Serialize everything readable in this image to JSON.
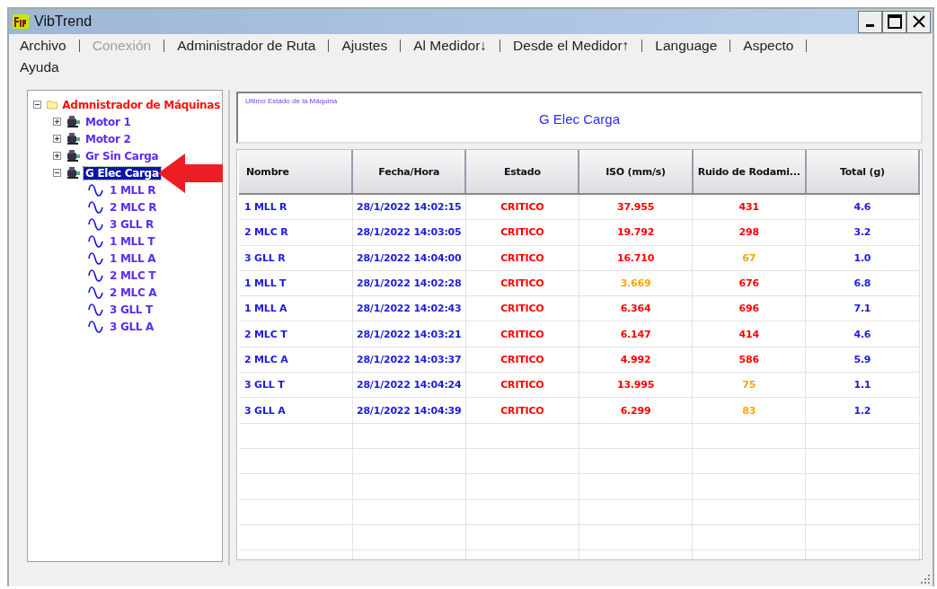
{
  "window": {
    "title": "VibTrend"
  },
  "menu": [
    {
      "label": "Archivo",
      "disabled": false
    },
    {
      "label": "Conexión",
      "disabled": true
    },
    {
      "label": "Administrador de Ruta",
      "disabled": false
    },
    {
      "label": "Ajustes",
      "disabled": false
    },
    {
      "label": "Al Medidor↓",
      "disabled": false
    },
    {
      "label": "Desde el Medidor↑",
      "disabled": false
    },
    {
      "label": "Language",
      "disabled": false
    },
    {
      "label": "Aspecto",
      "disabled": false
    },
    {
      "label": "Ayuda",
      "disabled": false
    }
  ],
  "tree": {
    "label": "Admnistrador de Máquinas",
    "kind": "folder",
    "expanded": true,
    "selected": false,
    "children": [
      {
        "label": "Motor 1",
        "kind": "machine",
        "expanded": false,
        "selected": false
      },
      {
        "label": "Motor 2",
        "kind": "machine",
        "expanded": false,
        "selected": false
      },
      {
        "label": "Gr Sin Carga",
        "kind": "machine",
        "expanded": false,
        "selected": false
      },
      {
        "label": "G Elec Carga",
        "kind": "machine",
        "expanded": true,
        "selected": true,
        "children": [
          {
            "label": "1 MLL R",
            "kind": "point",
            "selected": false
          },
          {
            "label": "2 MLC R",
            "kind": "point",
            "selected": false
          },
          {
            "label": "3 GLL R",
            "kind": "point",
            "selected": false
          },
          {
            "label": "1 MLL T",
            "kind": "point",
            "selected": false
          },
          {
            "label": "1 MLL A",
            "kind": "point",
            "selected": false
          },
          {
            "label": "2 MLC T",
            "kind": "point",
            "selected": false
          },
          {
            "label": "2 MLC A",
            "kind": "point",
            "selected": false
          },
          {
            "label": "3 GLL T",
            "kind": "point",
            "selected": false
          },
          {
            "label": "3 GLL A",
            "kind": "point",
            "selected": false
          }
        ]
      }
    ]
  },
  "status_panel": {
    "caption": "Ultimo Estado de la Máquina",
    "machine": "G Elec Carga"
  },
  "table": {
    "columns": [
      "Nombre",
      "Fecha/Hora",
      "Estado",
      "ISO (mm/s)",
      "Ruido de Rodami...",
      "Total (g)"
    ],
    "rows": [
      {
        "name": "1 MLL R",
        "datetime": "28/1/2022 14:02:15",
        "status": "CRITICO",
        "iso": {
          "text": "37.955",
          "color": "#ff0000"
        },
        "noise": {
          "text": "431",
          "color": "#ff0000"
        },
        "total": "4.6"
      },
      {
        "name": "2 MLC R",
        "datetime": "28/1/2022 14:03:05",
        "status": "CRITICO",
        "iso": {
          "text": "19.792",
          "color": "#ff0000"
        },
        "noise": {
          "text": "298",
          "color": "#ff0000"
        },
        "total": "3.2"
      },
      {
        "name": "3 GLL R",
        "datetime": "28/1/2022 14:04:00",
        "status": "CRITICO",
        "iso": {
          "text": "16.710",
          "color": "#ff0000"
        },
        "noise": {
          "text": "67",
          "color": "#ffa500"
        },
        "total": "1.0"
      },
      {
        "name": "1 MLL T",
        "datetime": "28/1/2022 14:02:28",
        "status": "CRITICO",
        "iso": {
          "text": "3.669",
          "color": "#ffa500"
        },
        "noise": {
          "text": "676",
          "color": "#ff0000"
        },
        "total": "6.8"
      },
      {
        "name": "1 MLL A",
        "datetime": "28/1/2022 14:02:43",
        "status": "CRITICO",
        "iso": {
          "text": "6.364",
          "color": "#ff0000"
        },
        "noise": {
          "text": "696",
          "color": "#ff0000"
        },
        "total": "7.1"
      },
      {
        "name": "2 MLC T",
        "datetime": "28/1/2022 14:03:21",
        "status": "CRITICO",
        "iso": {
          "text": "6.147",
          "color": "#ff0000"
        },
        "noise": {
          "text": "414",
          "color": "#ff0000"
        },
        "total": "4.6"
      },
      {
        "name": "2 MLC A",
        "datetime": "28/1/2022 14:03:37",
        "status": "CRITICO",
        "iso": {
          "text": "4.992",
          "color": "#ff0000"
        },
        "noise": {
          "text": "586",
          "color": "#ff0000"
        },
        "total": "5.9"
      },
      {
        "name": "3 GLL T",
        "datetime": "28/1/2022 14:04:24",
        "status": "CRITICO",
        "iso": {
          "text": "13.995",
          "color": "#ff0000"
        },
        "noise": {
          "text": "75",
          "color": "#ffa500"
        },
        "total": "1.1"
      },
      {
        "name": "3 GLL A",
        "datetime": "28/1/2022 14:04:39",
        "status": "CRITICO",
        "iso": {
          "text": "6.299",
          "color": "#ff0000"
        },
        "noise": {
          "text": "83",
          "color": "#ffa500"
        },
        "total": "1.2"
      }
    ]
  }
}
